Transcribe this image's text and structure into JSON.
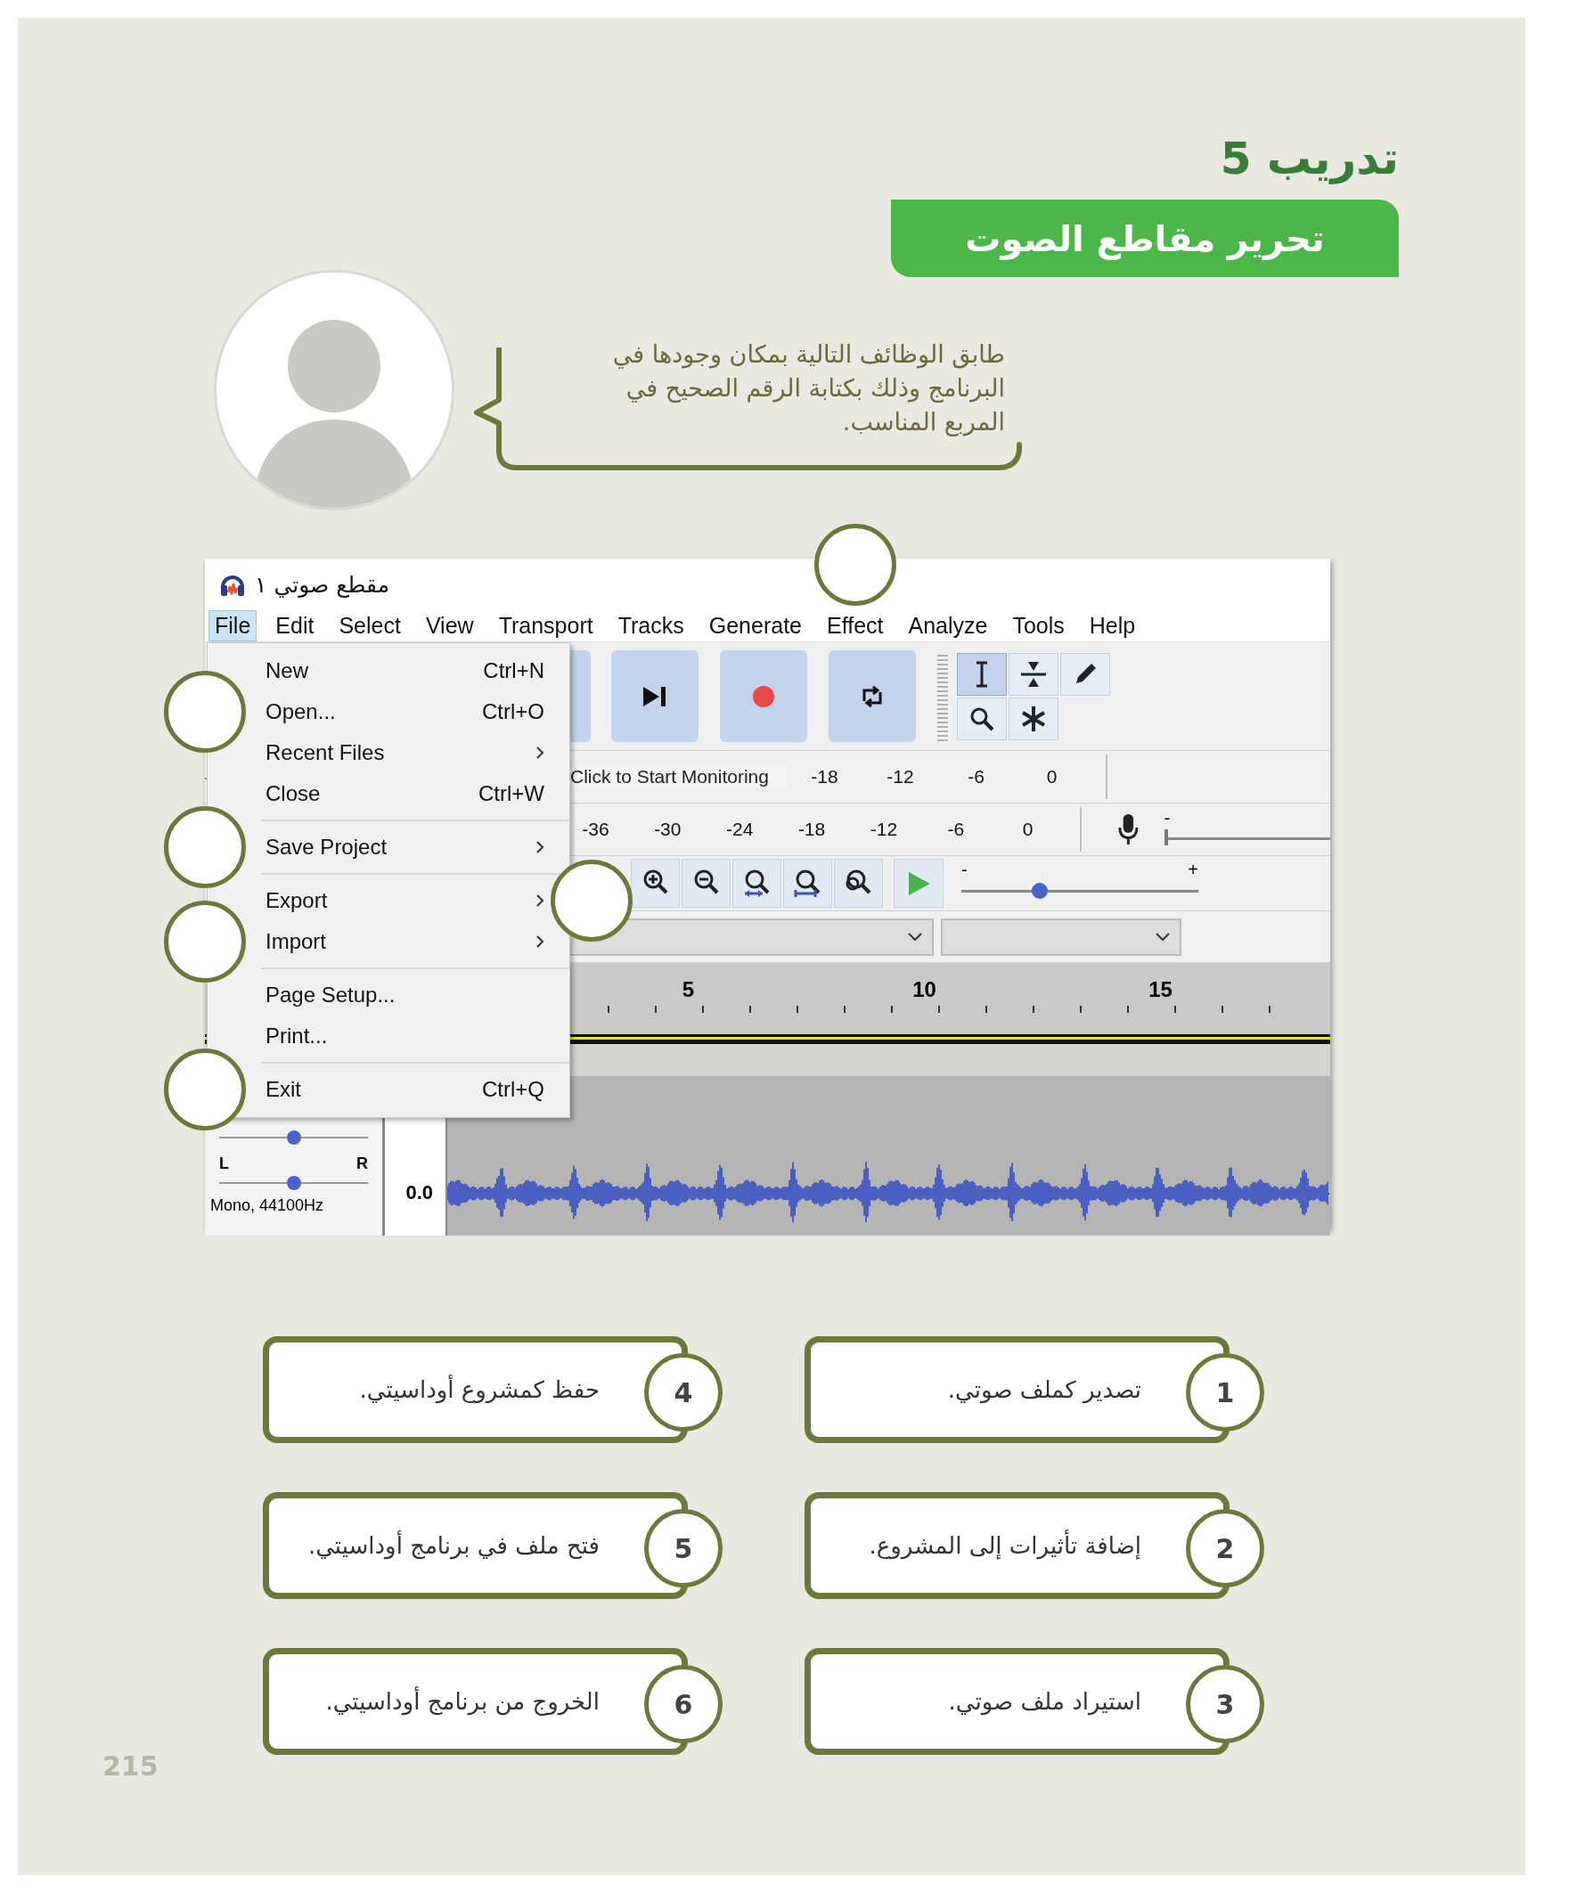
{
  "exercise": {
    "title": "تدريب 5",
    "banner": "تحرير مقاطع الصوت"
  },
  "instruction": "طابق الوظائف التالية بمكان وجودها في البرنامج وذلك بكتابة الرقم الصحيح في المربع المناسب.",
  "window": {
    "title": "مقطع صوتي ١",
    "menu_bar": [
      {
        "label": "File",
        "selected": true
      },
      {
        "label": "Edit",
        "selected": false
      },
      {
        "label": "Select",
        "selected": false
      },
      {
        "label": "View",
        "selected": false
      },
      {
        "label": "Transport",
        "selected": false
      },
      {
        "label": "Tracks",
        "selected": false
      },
      {
        "label": "Generate",
        "selected": false
      },
      {
        "label": "Effect",
        "selected": false,
        "answer_box": {
          "kind": "above"
        }
      },
      {
        "label": "Analyze",
        "selected": false
      },
      {
        "label": "Tools",
        "selected": false
      },
      {
        "label": "Help",
        "selected": false
      }
    ],
    "file_menu": [
      {
        "kind": "item",
        "label": "New",
        "shortcut": "Ctrl+N"
      },
      {
        "kind": "item",
        "label": "Open...",
        "shortcut": "Ctrl+O",
        "answer_box": {
          "kind": "left"
        }
      },
      {
        "kind": "submenu",
        "label": "Recent Files"
      },
      {
        "kind": "item",
        "label": "Close",
        "shortcut": "Ctrl+W"
      },
      {
        "kind": "separator"
      },
      {
        "kind": "submenu",
        "label": "Save Project",
        "answer_box": {
          "kind": "left"
        }
      },
      {
        "kind": "separator"
      },
      {
        "kind": "submenu",
        "label": "Export",
        "answer_box": {
          "kind": "right"
        }
      },
      {
        "kind": "submenu",
        "label": "Import",
        "answer_box": {
          "kind": "left"
        }
      },
      {
        "kind": "separator"
      },
      {
        "kind": "item",
        "label": "Page Setup..."
      },
      {
        "kind": "item",
        "label": "Print..."
      },
      {
        "kind": "separator"
      },
      {
        "kind": "item",
        "label": "Exit",
        "shortcut": "Ctrl+Q",
        "answer_box": {
          "kind": "left"
        }
      }
    ],
    "tools": [
      {
        "selected": true
      },
      {
        "selected": false
      },
      {
        "selected": false
      },
      {
        "selected": false
      },
      {
        "selected": false
      }
    ],
    "recording_meter": {
      "prompt": "Click to Start Monitoring",
      "ticks": [
        "-18",
        "-12",
        "-6",
        "0"
      ]
    },
    "playback_meter": {
      "ticks": [
        "-36",
        "-30",
        "-24",
        "-18",
        "-12",
        "-6",
        "0"
      ]
    },
    "mic_slider": {
      "minus": "-",
      "level": 0
    },
    "playback_speed": {
      "minus": "-",
      "plus": "+",
      "level": 0.33
    },
    "ruler": [
      "5",
      "10",
      "15"
    ],
    "track": {
      "pan_left": "L",
      "pan_right": "R",
      "gain_slider": {
        "level": 0.5
      },
      "pan_slider": {
        "level": 0.5
      },
      "format": "Mono, 44100Hz",
      "scale": "0.0"
    }
  },
  "card_columns": [
    {
      "cards": [
        {
          "number": "1",
          "text": "تصدير كملف صوتي."
        },
        {
          "number": "2",
          "text": "إضافة تأثيرات إلى المشروع."
        },
        {
          "number": "3",
          "text": "استيراد ملف صوتي."
        }
      ]
    },
    {
      "cards": [
        {
          "number": "4",
          "text": "حفظ كمشروع أوداسيتي."
        },
        {
          "number": "5",
          "text": "فتح ملف في برنامج أوداسيتي."
        },
        {
          "number": "6",
          "text": "الخروج من برنامج أوداسيتي."
        }
      ]
    }
  ],
  "page_number": "215"
}
